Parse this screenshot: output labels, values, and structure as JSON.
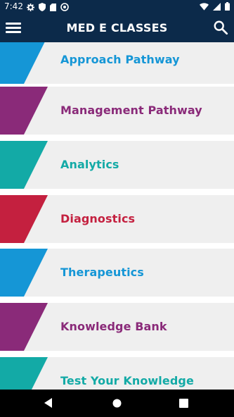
{
  "status_bar": {
    "time": "7:42",
    "left_icons": [
      "gear-icon",
      "shield-icon",
      "sd-card-icon",
      "sync-circle-icon"
    ],
    "right_icons": [
      "wifi-icon",
      "cellular-signal-icon",
      "battery-icon"
    ]
  },
  "app_bar": {
    "title": "MED E CLASSES",
    "menu_icon": "hamburger-menu-icon",
    "search_icon": "search-icon"
  },
  "menu": {
    "items": [
      {
        "label": "Approach Pathway",
        "color": "#1596d6"
      },
      {
        "label": "Management Pathway",
        "color": "#8a2a79"
      },
      {
        "label": "Analytics",
        "color": "#13aaa6"
      },
      {
        "label": "Diagnostics",
        "color": "#c4203f"
      },
      {
        "label": "Therapeutics",
        "color": "#1596d6"
      },
      {
        "label": "Knowledge Bank",
        "color": "#8a2a79"
      },
      {
        "label": "Test Your Knowledge",
        "color": "#13aaa6"
      }
    ]
  },
  "nav_bar": {
    "icons": [
      "back-triangle-icon",
      "home-circle-icon",
      "recents-square-icon"
    ]
  },
  "colors": {
    "app_bar_bg": "#0c2a4a",
    "item_bg": "#efefef",
    "nav_bg": "#000000"
  }
}
